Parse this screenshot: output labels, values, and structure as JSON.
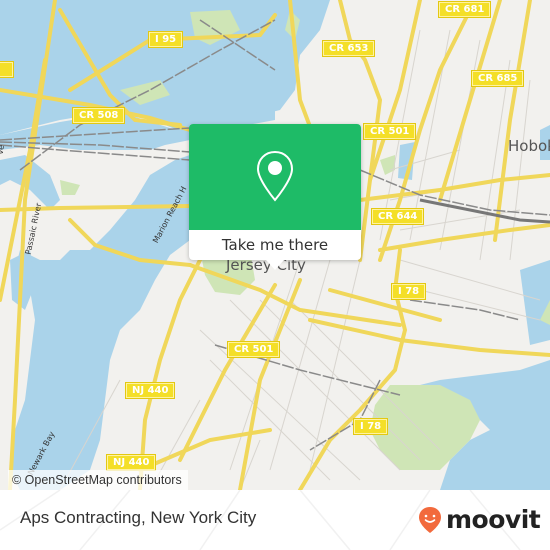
{
  "map": {
    "place_labels": {
      "jersey_city": "Jersey City",
      "hoboken": "Hobok"
    },
    "water_labels": {
      "passaic_river": "Passaic River",
      "marion_reach": "Marion Reach H",
      "newark_bay": "Newark Bay",
      "left_edge": "ve"
    },
    "road_shields": [
      {
        "id": "i95",
        "label": "I 95"
      },
      {
        "id": "cr508",
        "label": "CR 508"
      },
      {
        "id": "cr653",
        "label": "CR 653"
      },
      {
        "id": "cr681",
        "label": "CR 681"
      },
      {
        "id": "cr685",
        "label": "CR 685"
      },
      {
        "id": "cr501-north",
        "label": "CR 501"
      },
      {
        "id": "cr644",
        "label": "CR 644"
      },
      {
        "id": "i78-north",
        "label": "I 78"
      },
      {
        "id": "cr501-south",
        "label": "CR 501"
      },
      {
        "id": "nj440-north",
        "label": "NJ 440"
      },
      {
        "id": "i78-south",
        "label": "I 78"
      },
      {
        "id": "nj440-south",
        "label": "NJ 440"
      }
    ],
    "attribution": "© OpenStreetMap contributors",
    "colors": {
      "land": "#f2f1ee",
      "water": "#aad3ea",
      "park": "#cfe5b6",
      "road": "#f7e36a",
      "rail": "#888888",
      "popup_accent": "#1ebb67"
    }
  },
  "popup": {
    "icon": "map-pin-icon",
    "button_label": "Take me there"
  },
  "footer": {
    "title": "Aps Contracting, New York City",
    "brand": "moovit",
    "brand_color": "#f26a3d"
  }
}
